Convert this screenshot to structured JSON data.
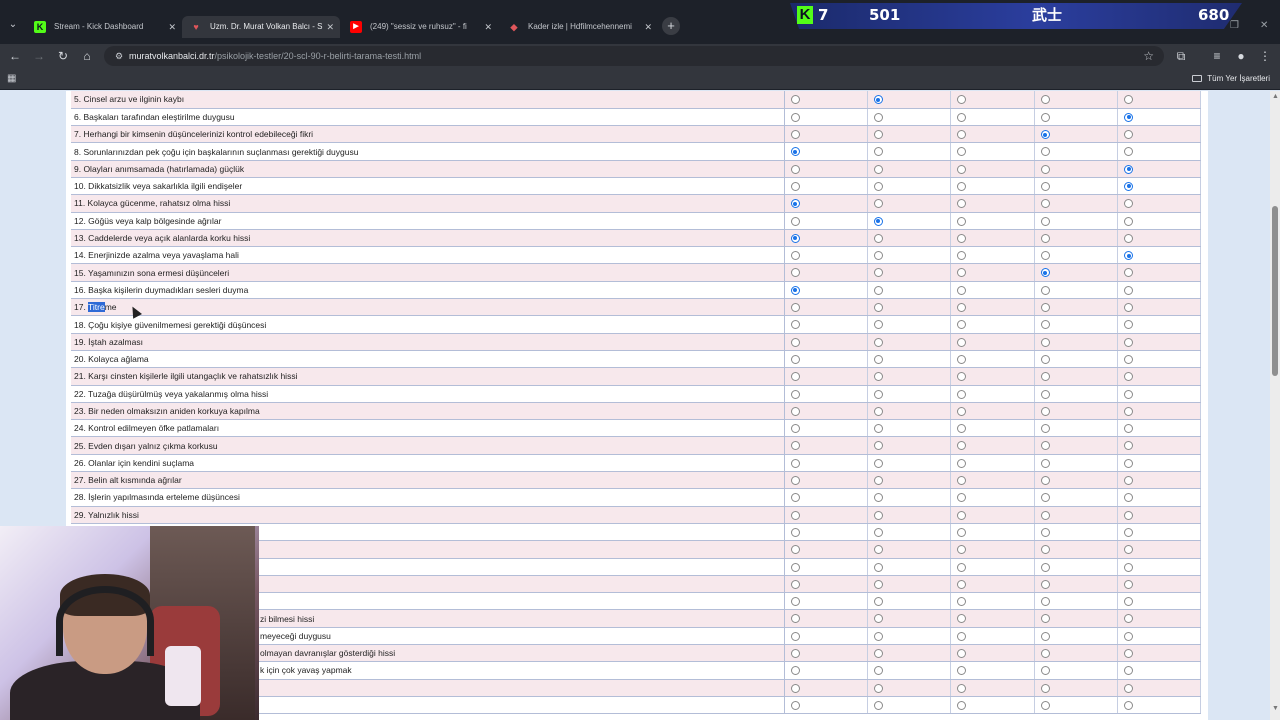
{
  "browser": {
    "tabs": [
      {
        "title": "Stream - Kick Dashboard",
        "favicon": "kick-icon",
        "fav_color": "#53fc18",
        "fav_glyph": "K",
        "active": false
      },
      {
        "title": "Uzm. Dr. Murat Volkan Balcı - S",
        "favicon": "heart-icon",
        "fav_color": "#e0565b",
        "fav_glyph": "♥",
        "active": true
      },
      {
        "title": "(249) \"sessiz ve ruhsuz\" - fi",
        "favicon": "youtube-icon",
        "fav_color": "#ff0000",
        "fav_glyph": "▶",
        "active": false
      },
      {
        "title": "Kader izle | Hdfilmcehennemi",
        "favicon": "film-icon",
        "fav_color": "#e0565b",
        "fav_glyph": "◆",
        "active": false
      }
    ],
    "url_host": "muratvolkanbalci.dr.tr",
    "url_path": "/psikolojik-testler/20-scl-90-r-belirti-tarama-testi.html",
    "all_bookmarks": "Tüm Yer İşaretleri"
  },
  "overlay": {
    "k_glyph": "K",
    "v1": "7",
    "v2": "501",
    "v3": "武士",
    "v4": "680"
  },
  "questions": [
    {
      "text": "5. Cinsel arzu ve ilginin kaybı",
      "sel": 1
    },
    {
      "text": "6. Başkaları tarafından eleştirilme duygusu",
      "sel": 4
    },
    {
      "text": "7. Herhangi bir kimsenin düşüncelerinizi kontrol edebileceği fikri",
      "sel": 3
    },
    {
      "text": "8. Sorunlarınızdan pek çoğu için başkalarının suçlanması gerektiği duygusu",
      "sel": 0
    },
    {
      "text": "9. Olayları anımsamada (hatırlamada) güçlük",
      "sel": 4
    },
    {
      "text": "10. Dikkatsizlik veya sakarlıkla ilgili endişeler",
      "sel": 4
    },
    {
      "text": "11. Kolayca gücenme, rahatsız olma hissi",
      "sel": 0
    },
    {
      "text": "12. Göğüs veya kalp bölgesinde ağrılar",
      "sel": 1
    },
    {
      "text": "13. Caddelerde veya açık alanlarda korku hissi",
      "sel": 0
    },
    {
      "text": "14. Enerjinizde azalma veya yavaşlama hali",
      "sel": 4
    },
    {
      "text": "15. Yaşamınızın sona ermesi düşünceleri",
      "sel": 3
    },
    {
      "text": "16. Başka kişilerin duymadıkları sesleri duyma",
      "sel": 0
    },
    {
      "text": "17. Titreme",
      "sel": null,
      "highlight_prefix": "17. ",
      "highlight_text": "Titre",
      "highlight_rest": "me"
    },
    {
      "text": "18. Çoğu kişiye güvenilmemesi gerektiği düşüncesi",
      "sel": null
    },
    {
      "text": "19. İştah azalması",
      "sel": null
    },
    {
      "text": "20. Kolayca ağlama",
      "sel": null
    },
    {
      "text": "21. Karşı cinsten kişilerle ilgili utangaçlık ve rahatsızlık hissi",
      "sel": null
    },
    {
      "text": "22. Tuzağa düşürülmüş veya yakalanmış olma hissi",
      "sel": null
    },
    {
      "text": "23. Bir neden olmaksızın aniden korkuya kapılma",
      "sel": null
    },
    {
      "text": "24. Kontrol edilmeyen öfke patlamaları",
      "sel": null
    },
    {
      "text": "25. Evden dışarı yalnız çıkma korkusu",
      "sel": null
    },
    {
      "text": "26. Olanlar için kendini suçlama",
      "sel": null
    },
    {
      "text": "27. Belin alt kısmında ağrılar",
      "sel": null
    },
    {
      "text": "28. İşlerin yapılmasında erteleme düşüncesi",
      "sel": null
    },
    {
      "text": "29. Yalnızlık hissi",
      "sel": null
    },
    {
      "text": "",
      "sel": null
    },
    {
      "text": "",
      "sel": null
    },
    {
      "text": "",
      "sel": null
    },
    {
      "text": "",
      "sel": null
    },
    {
      "text": "",
      "sel": null
    },
    {
      "text": "zi bilmesi hissi",
      "sel": null,
      "indent": true
    },
    {
      "text": "meyeceği duygusu",
      "sel": null,
      "indent": true
    },
    {
      "text": "olmayan davranışlar gösterdiği hissi",
      "sel": null,
      "indent": true
    },
    {
      "text": "k için çok yavaş yapmak",
      "sel": null,
      "indent": true
    },
    {
      "text": "",
      "sel": null
    },
    {
      "text": "",
      "sel": null
    }
  ]
}
